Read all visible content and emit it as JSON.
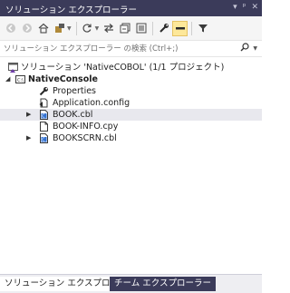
{
  "window": {
    "title": "ソリューション エクスプローラー",
    "title_controls": [
      "▾",
      "ᵖ",
      "✕"
    ]
  },
  "toolbar": {
    "buttons": [
      {
        "name": "back",
        "glyph": "◀",
        "disabled": true
      },
      {
        "name": "forward",
        "glyph": "▶",
        "disabled": true
      },
      {
        "name": "home",
        "glyph": "⌂"
      },
      {
        "name": "switch-views",
        "glyph": "☗"
      },
      {
        "name": "pending-changes",
        "glyph": "⟲"
      },
      {
        "name": "sync-with-active-document",
        "glyph": "⇆"
      },
      {
        "name": "collapse-all",
        "glyph": "❐"
      },
      {
        "name": "show-all-files",
        "glyph": "▣"
      },
      {
        "name": "properties",
        "glyph": "🔧"
      },
      {
        "name": "preview-selected-items",
        "glyph": "▬",
        "active": true
      },
      {
        "name": "filter",
        "glyph": "▼"
      }
    ]
  },
  "search": {
    "placeholder": "ソリューション エクスプローラー の検索 (Ctrl+;)"
  },
  "tree": {
    "solution": "ソリューション 'NativeCOBOL' (1/1 プロジェクト)",
    "project": "NativeConsole",
    "items": [
      {
        "label": "Properties",
        "icon": "wrench-icon"
      },
      {
        "label": "Application.config",
        "icon": "config-icon"
      },
      {
        "label": "BOOK.cbl",
        "icon": "cobol-file-icon",
        "expandable": true,
        "selected": true
      },
      {
        "label": "BOOK-INFO.cpy",
        "icon": "file-icon"
      },
      {
        "label": "BOOKSCRN.cbl",
        "icon": "cobol-file-icon",
        "expandable": true
      }
    ]
  },
  "tabs": [
    {
      "label": "ソリューション エクスプローラー",
      "active": true
    },
    {
      "label": "チーム エクスプローラー",
      "active": false
    }
  ]
}
